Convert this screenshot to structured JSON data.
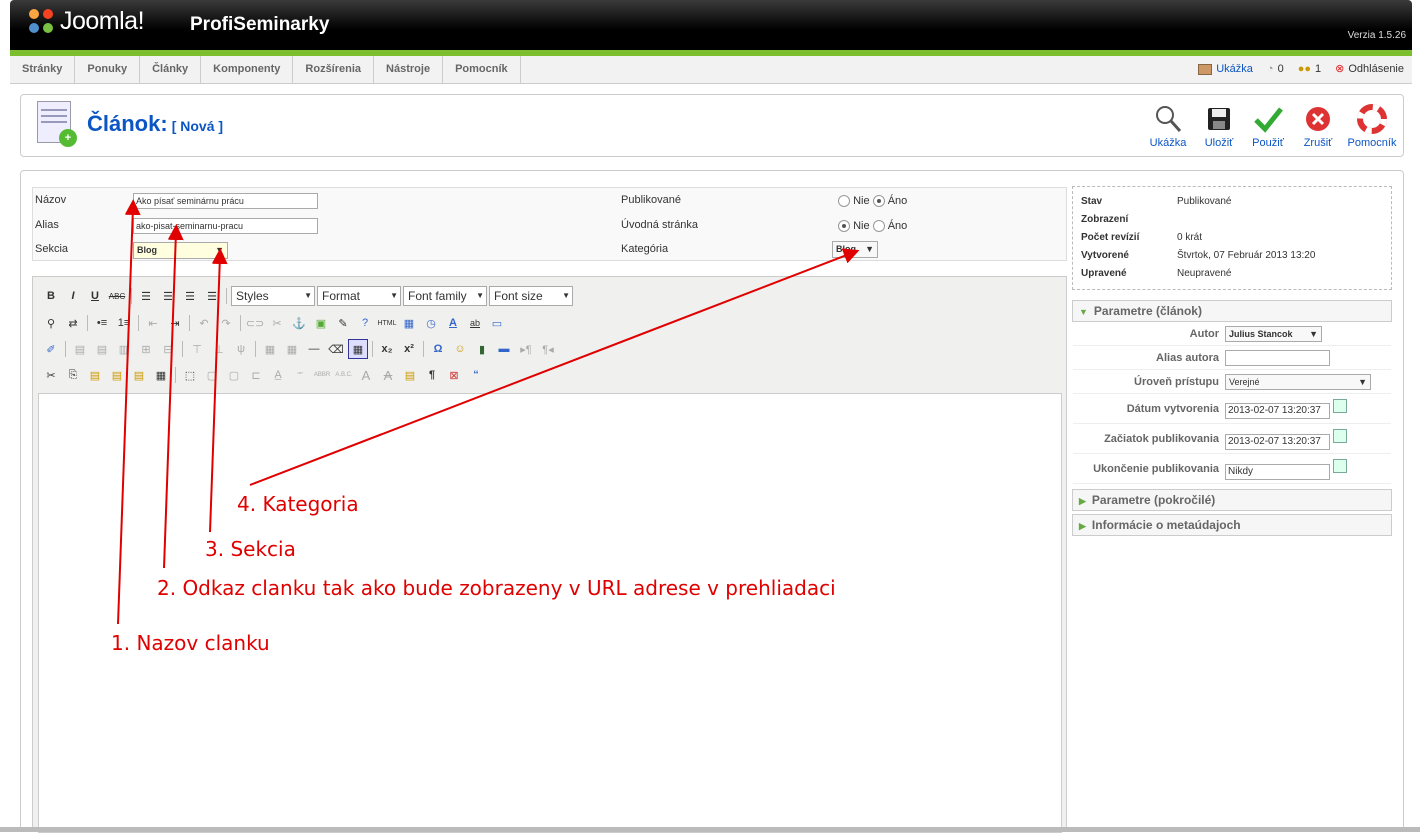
{
  "header": {
    "logo_text": "Joomla!",
    "site_name": "ProfiSeminarky",
    "version": "Verzia 1.5.26"
  },
  "menu": [
    "Stránky",
    "Ponuky",
    "Články",
    "Komponenty",
    "Rozšírenia",
    "Nástroje",
    "Pomocník"
  ],
  "status": {
    "preview": "Ukážka",
    "messages": "0",
    "users": "1",
    "logout": "Odhlásenie"
  },
  "toolbar": {
    "title": "Článok:",
    "subtitle": "[ Nová ]",
    "buttons": [
      "Ukážka",
      "Uložiť",
      "Použiť",
      "Zrušiť",
      "Pomocník"
    ]
  },
  "form": {
    "title_label": "Názov",
    "title_value": "Ako písať seminárnu prácu",
    "alias_label": "Alias",
    "alias_value": "ako-pisat-seminarnu-pracu",
    "section_label": "Sekcia",
    "section_value": "Blog",
    "published_label": "Publikované",
    "frontpage_label": "Úvodná stránka",
    "category_label": "Kategória",
    "category_value": "Blog",
    "no": "Nie",
    "yes": "Áno",
    "published_selected": "Áno",
    "frontpage_selected": "Nie"
  },
  "editor": {
    "styles": "Styles",
    "format": "Format",
    "font_family": "Font family",
    "font_size": "Font size"
  },
  "status_box": [
    {
      "label": "Stav",
      "value": "Publikované"
    },
    {
      "label": "Zobrazení",
      "value": ""
    },
    {
      "label": "Počet revízií",
      "value": "0 krát"
    },
    {
      "label": "Vytvorené",
      "value": "Štvrtok, 07 Február 2013 13:20"
    },
    {
      "label": "Upravené",
      "value": "Neupravené"
    }
  ],
  "params": {
    "header": "Parametre (článok)",
    "author_label": "Autor",
    "author_value": "Julius Stancok",
    "alias_author_label": "Alias autora",
    "alias_author_value": "",
    "access_label": "Úroveň prístupu",
    "access_value": "Verejné",
    "created_label": "Dátum vytvorenia",
    "created_value": "2013-02-07 13:20:37",
    "publish_up_label": "Začiatok publikovania",
    "publish_up_value": "2013-02-07 13:20:37",
    "publish_down_label": "Ukončenie publikovania",
    "publish_down_value": "Nikdy"
  },
  "accordions": [
    "Parametre (pokročilé)",
    "Informácie o metaúdajoch"
  ],
  "annotations": [
    "4. Kategoria",
    "3. Sekcia",
    "2. Odkaz clanku tak ako bude zobrazeny v URL adrese v prehliadaci",
    "1. Nazov clanku"
  ],
  "colors": {
    "green_bar": "#7bbf2e",
    "title_blue": "#0b55c4",
    "annotation_red": "#e00000"
  }
}
